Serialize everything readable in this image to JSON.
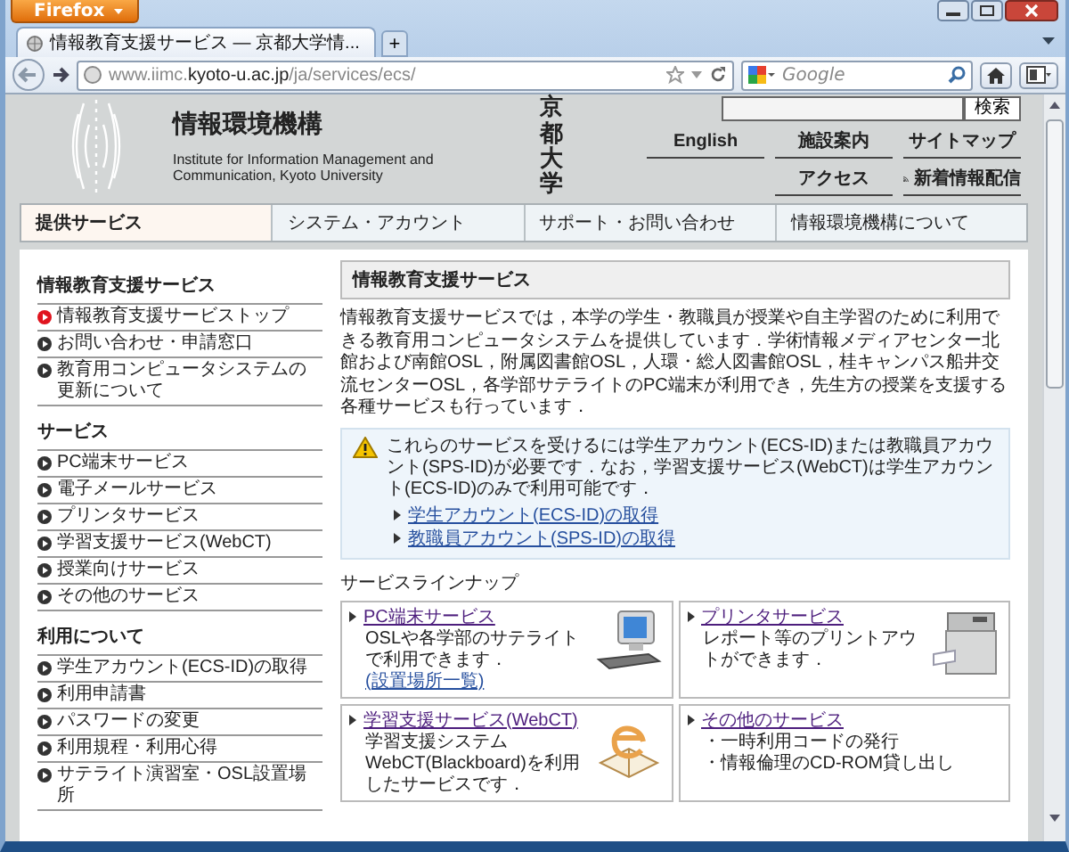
{
  "browser": {
    "menu_button": "Firefox",
    "tabs": [
      {
        "label": "情報教育支援サービス — 京都大学情...",
        "selected": true
      }
    ],
    "new_tab": "+",
    "url": {
      "subdomain": "www.iimc.",
      "domain": "kyoto-u.ac.jp",
      "path": "/ja/services/ecs/"
    },
    "search": {
      "placeholder": "Google"
    }
  },
  "header": {
    "title": "情報環境機構",
    "subtitle": "Institute for Information Management and Communication, Kyoto University",
    "university": "京都大学",
    "search_button": "検索",
    "links": [
      {
        "label": "English",
        "kind": "text"
      },
      {
        "label": "施設案内",
        "kind": "text"
      },
      {
        "label": "サイトマップ",
        "kind": "text"
      },
      {
        "label": "アクセス",
        "kind": "text"
      },
      {
        "label": "新着情報配信",
        "kind": "rss"
      }
    ]
  },
  "nav": [
    {
      "label": "提供サービス",
      "selected": true
    },
    {
      "label": "システム・アカウント",
      "selected": false
    },
    {
      "label": "サポート・お問い合わせ",
      "selected": false
    },
    {
      "label": "情報環境機構について",
      "selected": false
    }
  ],
  "sidebar": {
    "sections": [
      {
        "title": "情報教育支援サービス",
        "items": [
          {
            "label": "情報教育支援サービストップ",
            "selected": true
          },
          {
            "label": "お問い合わせ・申請窓口",
            "selected": false
          },
          {
            "label": "教育用コンピュータシステムの更新について",
            "selected": false
          }
        ]
      },
      {
        "title": "サービス",
        "items": [
          {
            "label": "PC端末サービス",
            "selected": false
          },
          {
            "label": "電子メールサービス",
            "selected": false
          },
          {
            "label": "プリンタサービス",
            "selected": false
          },
          {
            "label": "学習支援サービス(WebCT)",
            "selected": false
          },
          {
            "label": "授業向けサービス",
            "selected": false
          },
          {
            "label": "その他のサービス",
            "selected": false
          }
        ]
      },
      {
        "title": "利用について",
        "items": [
          {
            "label": "学生アカウント(ECS-ID)の取得",
            "selected": false
          },
          {
            "label": "利用申請書",
            "selected": false
          },
          {
            "label": "パスワードの変更",
            "selected": false
          },
          {
            "label": "利用規程・利用心得",
            "selected": false
          },
          {
            "label": "サテライト演習室・OSL設置場所",
            "selected": false
          }
        ]
      }
    ]
  },
  "main": {
    "heading": "情報教育支援サービス",
    "intro": "情報教育支援サービスでは，本学の学生・教職員が授業や自主学習のために利用できる教育用コンピュータシステムを提供しています．学術情報メディアセンター北館および南館OSL，附属図書館OSL，人環・総人図書館OSL，桂キャンパス船井交流センターOSL，各学部サテライトのPC端末が利用でき，先生方の授業を支援する各種サービスも行っています．",
    "notice": {
      "text": "これらのサービスを受けるには学生アカウント(ECS-ID)または教職員アカウント(SPS-ID)が必要です．なお，学習支援サービス(WebCT)は学生アカウント(ECS-ID)のみで利用可能です．",
      "links": [
        "学生アカウント(ECS-ID)の取得",
        "教職員アカウント(SPS-ID)の取得"
      ]
    },
    "lineup_title": "サービスラインナップ",
    "services": [
      {
        "title": "PC端末サービス",
        "description": "OSLや各学部のサテライトで利用できます．",
        "link": "(設置場所一覧)",
        "kind": "computer"
      },
      {
        "title": "プリンタサービス",
        "description": "レポート等のプリントアウトができます．",
        "kind": "printer"
      },
      {
        "title": "学習支援サービス(WebCT)",
        "description": "学習支援システムWebCT(Blackboard)を利用したサービスです．",
        "kind": "book"
      },
      {
        "title": "その他のサービス",
        "kind": "text",
        "items": [
          "・一時利用コードの発行",
          "・情報倫理のCD-ROM貸し出し"
        ]
      }
    ]
  }
}
